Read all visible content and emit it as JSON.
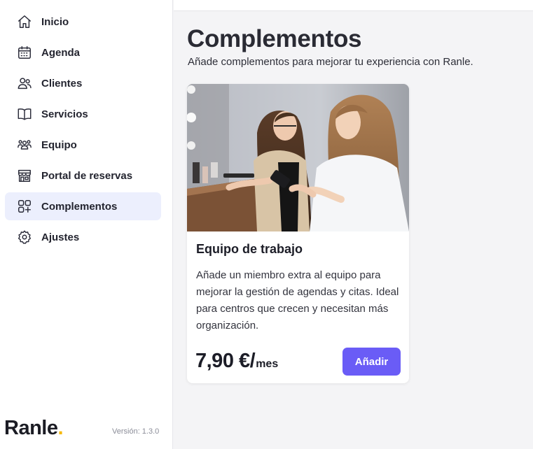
{
  "sidebar": {
    "items": [
      {
        "label": "Inicio",
        "icon": "home-icon",
        "active": false
      },
      {
        "label": "Agenda",
        "icon": "calendar-icon",
        "active": false
      },
      {
        "label": "Clientes",
        "icon": "users-icon",
        "active": false
      },
      {
        "label": "Servicios",
        "icon": "book-icon",
        "active": false
      },
      {
        "label": "Equipo",
        "icon": "team-icon",
        "active": false
      },
      {
        "label": "Portal de reservas",
        "icon": "storefront-icon",
        "active": false
      },
      {
        "label": "Complementos",
        "icon": "add-ons-icon",
        "active": true
      },
      {
        "label": "Ajustes",
        "icon": "gear-icon",
        "active": false
      }
    ],
    "brand": "Ranle",
    "brand_dot": ".",
    "version": "Versión: 1.3.0"
  },
  "main": {
    "title": "Complementos",
    "subtitle": "Añade complementos para mejorar tu experiencia con Ranle."
  },
  "card": {
    "title": "Equipo de trabajo",
    "description": "Añade un miembro extra al equipo para mejorar la gestión de agendas y citas. Ideal para centros que crecen y necesitan más organización.",
    "price": "7,90 €/",
    "price_unit": "mes",
    "button_label": "Añadir",
    "image": "photo-two-women-looking-at-phone"
  },
  "colors": {
    "accent": "#6a5cf6",
    "active_nav_bg": "#eceffd",
    "brand_dot": "#f5b800",
    "page_bg": "#f4f4f6"
  }
}
